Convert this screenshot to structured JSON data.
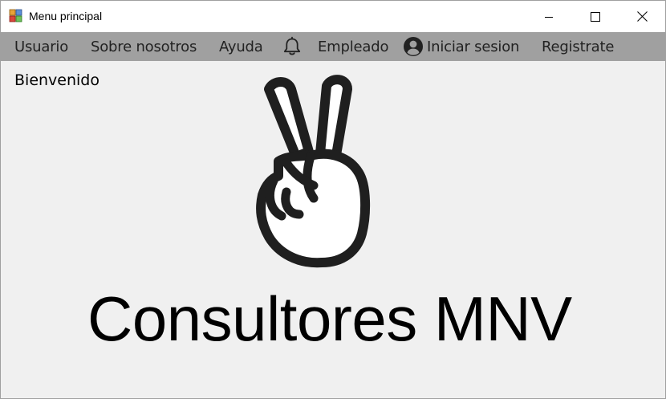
{
  "window": {
    "title": "Menu principal"
  },
  "menu": {
    "items": [
      {
        "label": "Usuario"
      },
      {
        "label": "Sobre nosotros"
      },
      {
        "label": "Ayuda"
      },
      {
        "label": "Empleado",
        "icon": "bell-icon"
      },
      {
        "label": "Iniciar sesion",
        "icon": "user-circle-icon"
      },
      {
        "label": "Registrate"
      }
    ]
  },
  "content": {
    "welcome": "Bienvenido",
    "brand": "Consultores MNV",
    "logo_icon": "peace-hand-icon"
  },
  "colors": {
    "menubar": "#a0a0a0",
    "background": "#f0f0f0",
    "titlebar": "#ffffff"
  }
}
